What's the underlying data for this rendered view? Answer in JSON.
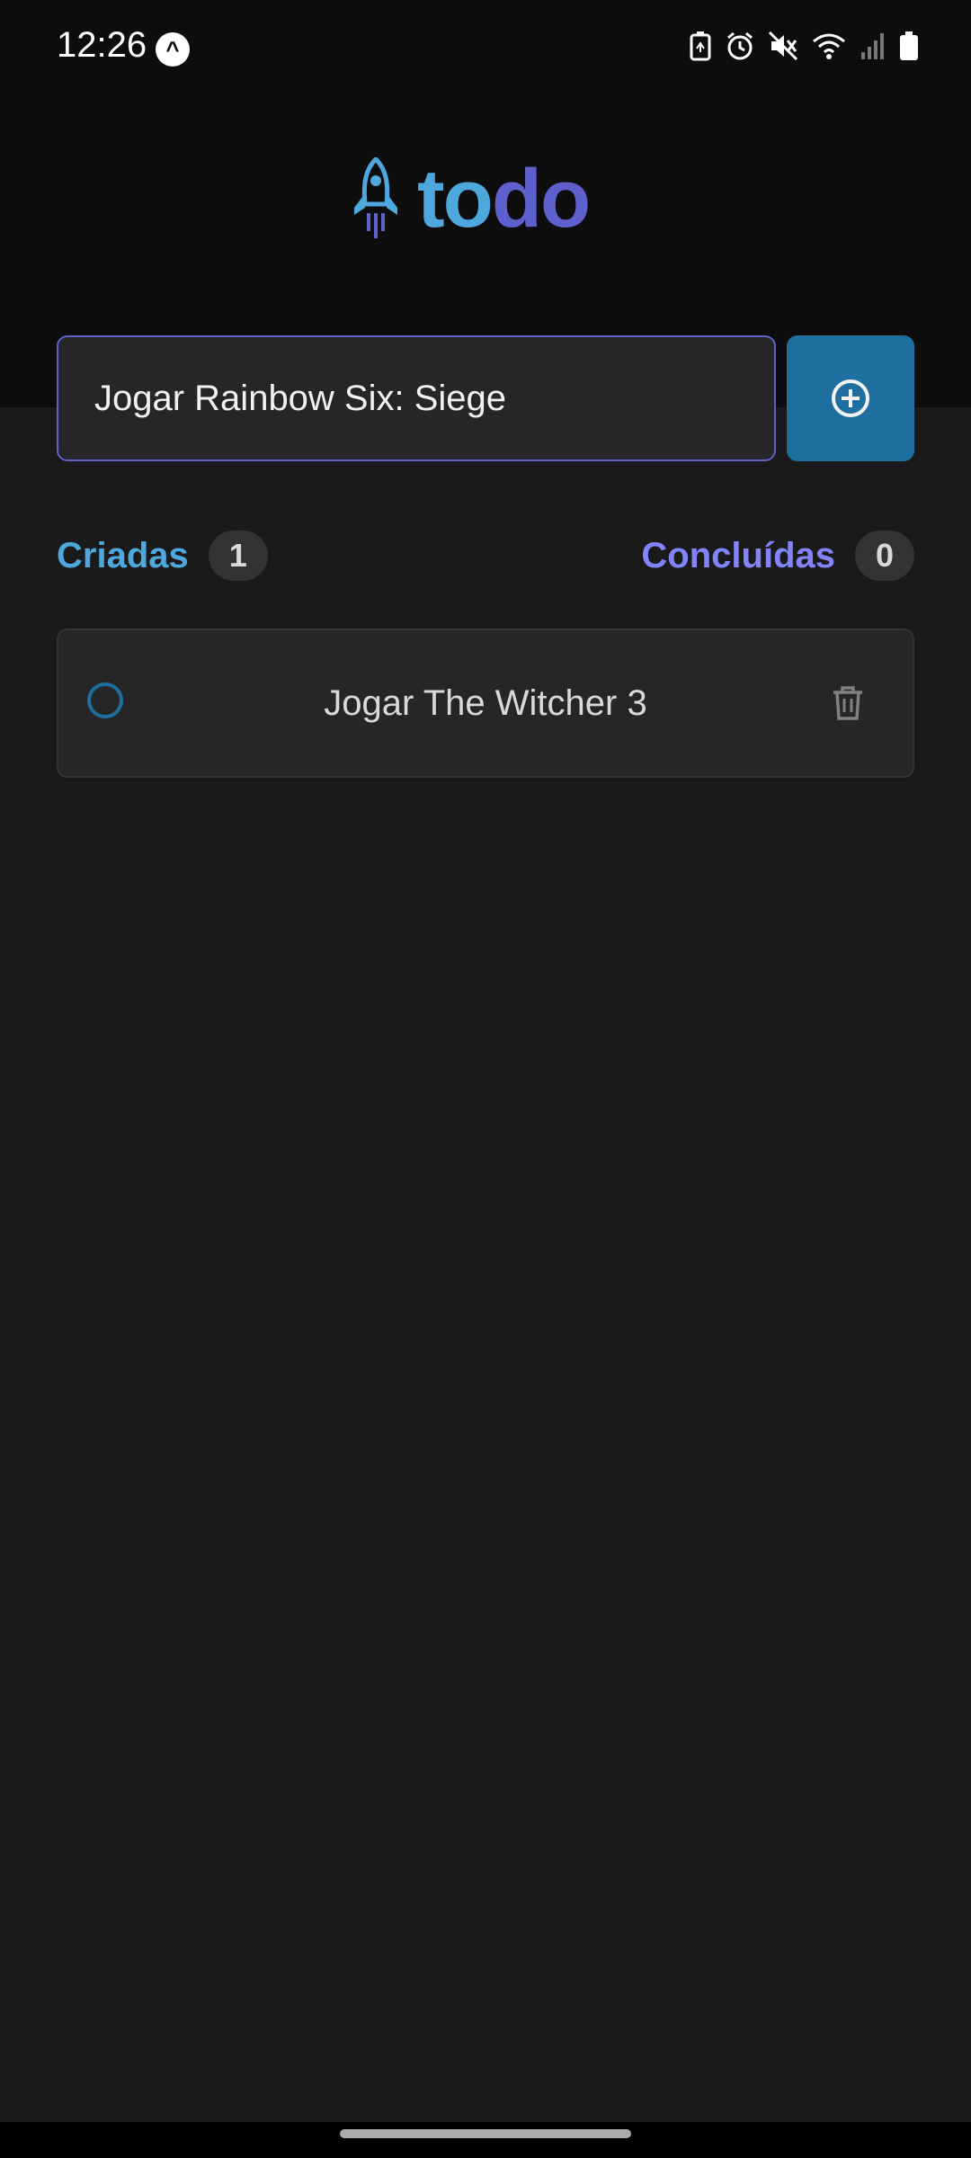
{
  "status_bar": {
    "time": "12:26",
    "notification_icon": "app-notification-icon",
    "icons": [
      "battery-saver-icon",
      "alarm-icon",
      "mute-icon",
      "wifi-icon",
      "signal-icon",
      "battery-icon"
    ]
  },
  "header": {
    "logo_icon": "rocket-icon",
    "logo_part1": "to",
    "logo_part2": "do"
  },
  "new_task": {
    "value": "Jogar Rainbow Six: Siege",
    "add_icon": "plus-circle-icon"
  },
  "counters": {
    "created_label": "Criadas",
    "created_count": "1",
    "completed_label": "Concluídas",
    "completed_count": "0"
  },
  "tasks": [
    {
      "text": "Jogar The Witcher 3",
      "completed": false,
      "delete_icon": "trash-icon"
    }
  ],
  "colors": {
    "background": "#1a1a1a",
    "header": "#0d0d0d",
    "blue": "#4ea8de",
    "blue_dark": "#1e6f9f",
    "purple": "#5e60ce",
    "purple_light": "#8284fa"
  }
}
